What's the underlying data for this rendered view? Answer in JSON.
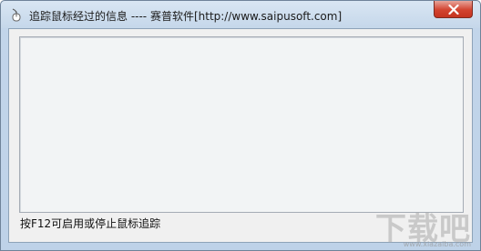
{
  "window": {
    "title": "追踪鼠标经过的信息 ---- 赛普软件[http://www.saipusoft.com]"
  },
  "status": {
    "text": "按F12可启用或停止鼠标追踪"
  },
  "watermark": {
    "logo_text": "下载吧",
    "url": "www.xiazaiba.com"
  },
  "colors": {
    "titlebar": "#c7d8ea",
    "close_button": "#c53420",
    "client_bg": "#f0f0f0",
    "log_bg": "#f2f4f5"
  }
}
